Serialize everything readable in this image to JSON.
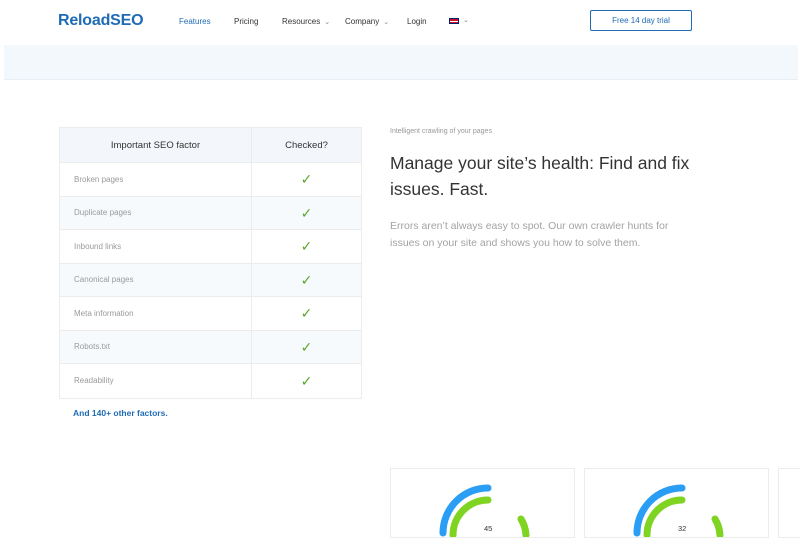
{
  "header": {
    "logo": "ReloadSEO",
    "nav": [
      {
        "label": "Features",
        "active": true
      },
      {
        "label": "Pricing",
        "active": false
      },
      {
        "label": "Resources",
        "has_dropdown": true
      },
      {
        "label": "Company",
        "has_dropdown": true
      },
      {
        "label": "Login",
        "active": false
      }
    ],
    "language": "flag-uk-icon",
    "cta_label": "Free 14 day trial"
  },
  "table": {
    "headers": [
      "Important SEO factor",
      "Checked?"
    ],
    "rows": [
      {
        "factor": "Broken pages",
        "checked": "✓"
      },
      {
        "factor": "Duplicate pages",
        "checked": "✓"
      },
      {
        "factor": "Inbound links",
        "checked": "✓"
      },
      {
        "factor": "Canonical pages",
        "checked": "✓"
      },
      {
        "factor": "Meta information",
        "checked": "✓"
      },
      {
        "factor": "Robots.txt",
        "checked": "✓"
      },
      {
        "factor": "Readability",
        "checked": "✓"
      }
    ],
    "more_link": "And 140+ other factors."
  },
  "feature": {
    "eyebrow": "Intelligent crawling of your pages",
    "headline": "Manage your site’s health: Find and fix issues. Fast.",
    "description": "Errors aren’t always easy to spot. Our own crawler hunts for issues on your site and shows you how to solve them."
  },
  "cards": [
    {
      "value": "45"
    },
    {
      "value": "32"
    }
  ],
  "colors": {
    "brand": "#1f6bb5",
    "check": "#5aa72b",
    "gauge_blue": "#2a9df4",
    "gauge_green": "#7fd321"
  }
}
